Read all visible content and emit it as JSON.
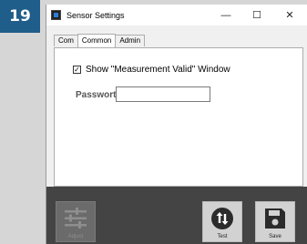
{
  "step": {
    "number": "19"
  },
  "window": {
    "title": "Sensor Settings",
    "controls": {
      "minimize": "—",
      "maximize": "☐",
      "close": "✕"
    }
  },
  "tabs": [
    {
      "label": "Com",
      "active": false
    },
    {
      "label": "Common",
      "active": true
    },
    {
      "label": "Admin",
      "active": false
    }
  ],
  "common": {
    "show_window_checkbox": {
      "checked": true,
      "mark": "✓",
      "label": "Show \"Measurement Valid\"  Window"
    },
    "password": {
      "label": "Passwort",
      "value": ""
    }
  },
  "toolbar": {
    "adjust": {
      "label": "Adjust",
      "icon": "sliders-icon",
      "enabled": false
    },
    "test": {
      "label": "Test",
      "icon": "swap-arrows-icon",
      "enabled": true
    },
    "save": {
      "label": "Save",
      "icon": "floppy-disk-icon",
      "enabled": true
    }
  },
  "colors": {
    "badge": "#1f5d8a",
    "toolbar_bg": "#444444",
    "button_bg": "#d2d2d2",
    "icon_dark": "#2b2b2b"
  }
}
